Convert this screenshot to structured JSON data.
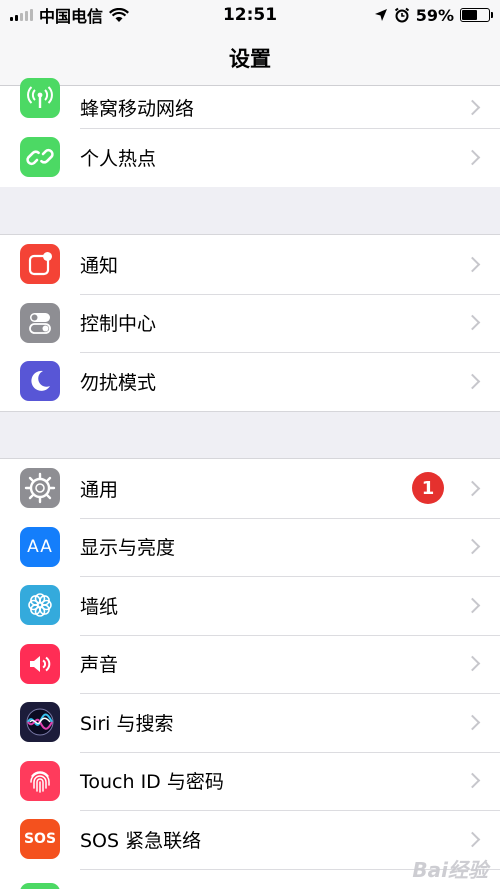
{
  "status_bar": {
    "carrier": "中国电信",
    "time": "12:51",
    "battery_percent": "59%",
    "battery_level": 0.59,
    "signal_bars": 2
  },
  "nav": {
    "title": "设置"
  },
  "groups": [
    {
      "items": [
        {
          "label": "蜂窝移动网络",
          "icon": "cellular-icon",
          "color": "#4cd964"
        },
        {
          "label": "个人热点",
          "icon": "hotspot-icon",
          "color": "#4cd964"
        }
      ]
    },
    {
      "items": [
        {
          "label": "通知",
          "icon": "notifications-icon",
          "color": "#f44336"
        },
        {
          "label": "控制中心",
          "icon": "control-center-icon",
          "color": "#8e8e93"
        },
        {
          "label": "勿扰模式",
          "icon": "moon-icon",
          "color": "#5856d6"
        }
      ]
    },
    {
      "items": [
        {
          "label": "通用",
          "icon": "gear-icon",
          "color": "#8e8e93",
          "badge": "1"
        },
        {
          "label": "显示与亮度",
          "icon": "display-icon",
          "color": "#147efb"
        },
        {
          "label": "墙纸",
          "icon": "wallpaper-icon",
          "color": "#34aadc"
        },
        {
          "label": "声音",
          "icon": "speaker-icon",
          "color": "#ff2d55"
        },
        {
          "label": "Siri 与搜索",
          "icon": "siri-icon",
          "color": "#1c1c3a"
        },
        {
          "label": "Touch ID 与密码",
          "icon": "fingerprint-icon",
          "color": "#ff3b5c"
        },
        {
          "label": "SOS 紧急联络",
          "icon": "sos-icon",
          "color": "#f4511e"
        }
      ]
    }
  ],
  "icon_text": {
    "display": "AA",
    "sos": "SOS"
  },
  "watermark": "Bai经验"
}
